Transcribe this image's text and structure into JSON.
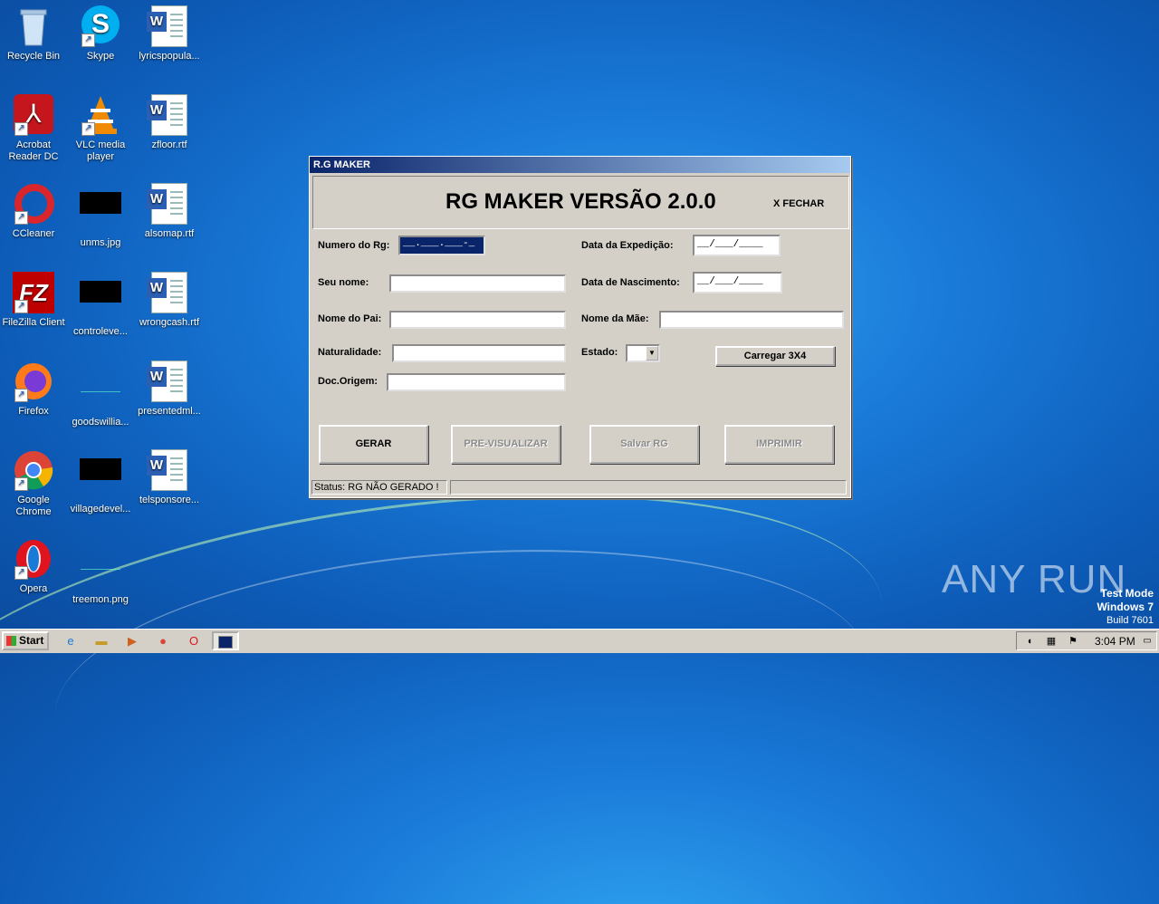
{
  "desktop": {
    "icons": [
      {
        "label": "Recycle Bin"
      },
      {
        "label": "Skype"
      },
      {
        "label": "lyricspopula..."
      },
      {
        "label": "Acrobat Reader DC"
      },
      {
        "label": "VLC media player"
      },
      {
        "label": "zfloor.rtf"
      },
      {
        "label": "CCleaner"
      },
      {
        "label": "unms.jpg"
      },
      {
        "label": "alsomap.rtf"
      },
      {
        "label": "FileZilla Client"
      },
      {
        "label": "controleve..."
      },
      {
        "label": "wrongcash.rtf"
      },
      {
        "label": "Firefox"
      },
      {
        "label": "goodswillia..."
      },
      {
        "label": "presentedml..."
      },
      {
        "label": "Google Chrome"
      },
      {
        "label": "villagedevel..."
      },
      {
        "label": "telsponsore..."
      },
      {
        "label": "Opera"
      },
      {
        "label": "treemon.png"
      }
    ]
  },
  "window": {
    "title": "R.G MAKER",
    "app_title": "RG MAKER VERSÃO 2.0.0",
    "close_label": "X FECHAR",
    "fields": {
      "rg_label": "Numero do Rg:",
      "rg_value": "__.___.___-_",
      "nome_label": "Seu nome:",
      "nome_value": "",
      "pai_label": "Nome do Pai:",
      "pai_value": "",
      "naturalidade_label": "Naturalidade:",
      "naturalidade_value": "",
      "doc_label": "Doc.Origem:",
      "doc_value": "",
      "expedicao_label": "Data da Expedição:",
      "expedicao_value": "__/___/____",
      "nascimento_label": "Data de Nascimento:",
      "nascimento_value": "__/___/____",
      "mae_label": "Nome da Mãe:",
      "mae_value": "",
      "estado_label": "Estado:",
      "estado_value": ""
    },
    "buttons": {
      "carregar": "Carregar  3X4",
      "gerar": "GERAR",
      "pre_visualizar": "PRE-VISUALIZAR",
      "salvar": "Salvar RG",
      "imprimir": "IMPRIMIR"
    },
    "status": "Status: RG NÃO GERADO !"
  },
  "watermark": {
    "text": "ANY RUN",
    "mode_line1": "Test Mode",
    "mode_line2": "Windows 7",
    "mode_line3": "Build 7601"
  },
  "taskbar": {
    "start_label": "Start",
    "clock": "3:04 PM"
  }
}
